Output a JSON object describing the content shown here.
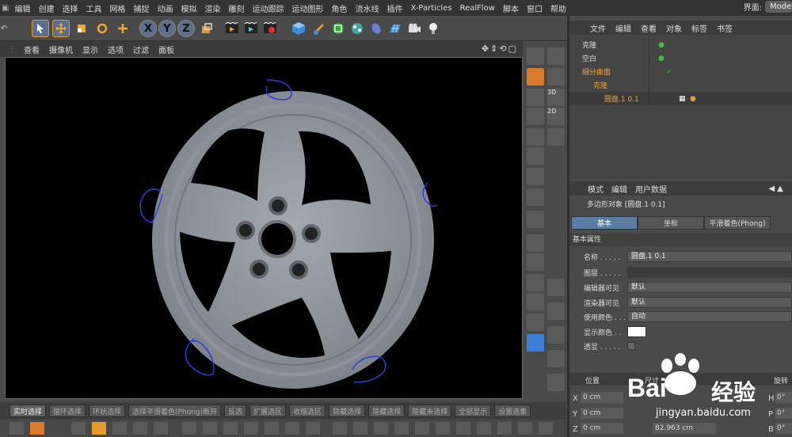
{
  "menu": [
    "编辑",
    "创建",
    "选择",
    "工具",
    "网格",
    "捕捉",
    "动画",
    "模拟",
    "渲染",
    "雕刻",
    "运动跟踪",
    "运动图形",
    "角色",
    "流水线",
    "插件",
    "X-Particles",
    "RealFlow",
    "脚本",
    "窗口",
    "帮助"
  ],
  "interface_label": "界面:",
  "interface_mode": "Mode",
  "toolbar_axes": [
    "X",
    "Y",
    "Z"
  ],
  "viewport_menu": [
    "查看",
    "摄像机",
    "显示",
    "选项",
    "过滤",
    "面板"
  ],
  "object_tabs": [
    "文件",
    "编辑",
    "查看",
    "对象",
    "标签",
    "书签"
  ],
  "objects": [
    {
      "name": "克隆",
      "indent": 0
    },
    {
      "name": "空白",
      "indent": 0
    },
    {
      "name": "细分曲面",
      "indent": 0
    },
    {
      "name": "克隆",
      "indent": 1
    },
    {
      "name": "圆盘.1 0.1",
      "indent": 2
    }
  ],
  "attr_tabs": [
    "模式",
    "编辑",
    "用户数据"
  ],
  "attr_object_title": "多边形对象 [圆盘.1 0.1]",
  "attr_subtabs": [
    "基本",
    "坐标",
    "平滑着色(Phong)"
  ],
  "attr_section": "基本属性",
  "attr_rows": [
    {
      "label": "名称 . . . . .",
      "value": "圆盘.1 0.1"
    },
    {
      "label": "图层 . . . . .",
      "value": ""
    },
    {
      "label": "编辑器可见",
      "value": "默认"
    },
    {
      "label": "渲染器可见",
      "value": "默认"
    },
    {
      "label": "使用颜色 . . .",
      "value": "自动"
    },
    {
      "label": "显示颜色 . .",
      "value": ""
    },
    {
      "label": "透显 . . . . .",
      "value": ""
    }
  ],
  "pos": {
    "title": "位置",
    "x": "0 cm",
    "y": "0 cm",
    "z": "0 cm",
    "size_title": "尺寸",
    "size_z": "82.963 cm",
    "rot_title": "旋转",
    "h": "H",
    "p": "P",
    "b": "B",
    "h_val": "0°",
    "p_val": "0°",
    "b_val": "0°"
  },
  "bottom_buttons": [
    "实时选择",
    "循环选择",
    "环状选择",
    "选择平滑着色(Phong)断开",
    "反选",
    "扩展选区",
    "收缩选区",
    "隐藏选择",
    "隐藏选择",
    "隐藏未选择",
    "全部显示",
    "设置选集"
  ],
  "watermark_text": "Bai",
  "watermark_text2": "经验",
  "watermark_url": "jingyan.baidu.com",
  "colors": {
    "accent_blue": "#5a7da1",
    "highlight_orange": "#e9a43a",
    "annotation_blue": "#2a3ed8"
  }
}
